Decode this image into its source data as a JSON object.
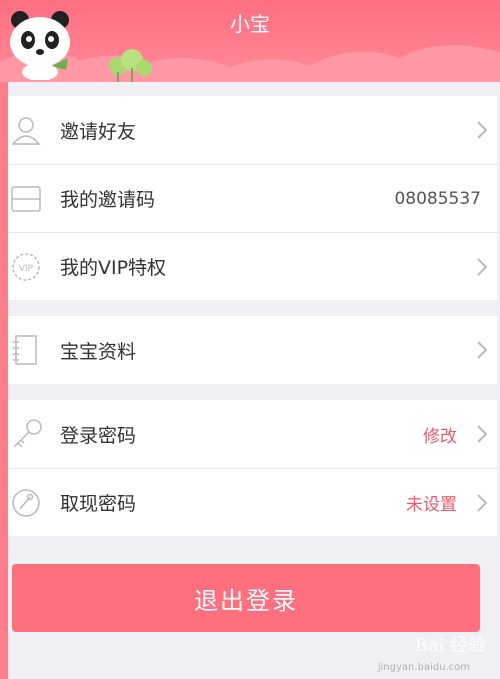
{
  "header": {
    "title": "小宝"
  },
  "groups": [
    {
      "rows": [
        {
          "label": "邀请好友",
          "value": "",
          "icon": "user-icon"
        },
        {
          "label": "我的邀请码",
          "value": "08085537",
          "icon": "card-icon"
        },
        {
          "label": "我的VIP特权",
          "value": "",
          "icon": "vip-badge-icon"
        }
      ]
    },
    {
      "rows": [
        {
          "label": "宝宝资料",
          "value": "",
          "icon": "notebook-icon"
        }
      ]
    },
    {
      "rows": [
        {
          "label": "登录密码",
          "value": "修改",
          "icon": "key-icon"
        },
        {
          "label": "取现密码",
          "value": "未设置",
          "icon": "lock-dial-icon"
        }
      ]
    }
  ],
  "logout": {
    "label": "退出登录"
  },
  "watermark": {
    "brand": "Bai 经验",
    "url": "jingyan.baidu.com"
  },
  "colors": {
    "accent": "#ff6f7d",
    "warning_text": "#f25868"
  }
}
